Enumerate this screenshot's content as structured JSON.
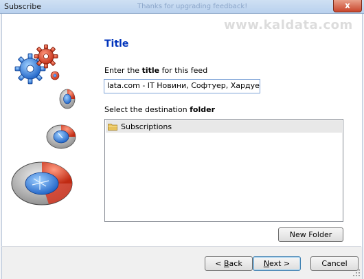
{
  "window": {
    "title": "Subscribe",
    "ghost_title": "Thanks for upgrading feedback!",
    "close_glyph": "x",
    "watermark": "www.kaldata.com"
  },
  "page": {
    "heading": "Title",
    "title_label_prefix": "Enter the ",
    "title_label_bold": "title",
    "title_label_suffix": " for this feed",
    "title_value": "lata.com - IT Новини, Софтуер, Хардуер, Игри",
    "folder_label_prefix": "Select the destination ",
    "folder_label_bold": "folder"
  },
  "tree": {
    "items": [
      {
        "label": "Subscriptions",
        "icon": "folder-icon"
      }
    ]
  },
  "buttons": {
    "new_folder": "New Folder",
    "back_prefix": "< ",
    "back_mnemonic": "B",
    "back_rest": "ack",
    "next_mnemonic": "N",
    "next_rest": "ext >",
    "cancel": "Cancel"
  },
  "colors": {
    "heading": "#0033bb",
    "field_border": "#7ba2d6",
    "gear_blue": "#1f6fd6",
    "gear_red": "#d8321c"
  }
}
